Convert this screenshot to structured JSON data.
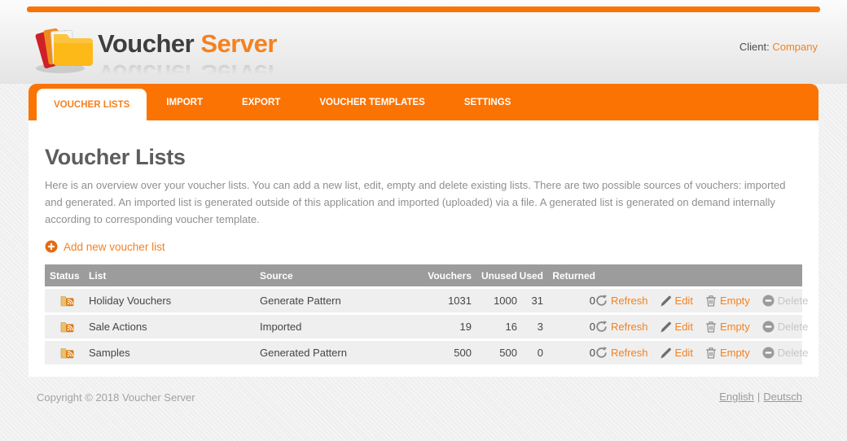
{
  "colors": {
    "accent_orange": "#fb7303",
    "link_orange": "#f5811f",
    "table_header_bg": "#9c9c9c",
    "row_bg": "#efefef",
    "disabled_text": "#c6c6c6"
  },
  "header": {
    "brand_primary": "Voucher",
    "brand_secondary": "Server",
    "client_label": "Client:",
    "client_name": "Company"
  },
  "nav": {
    "tabs": [
      {
        "label": "VOUCHER LISTS",
        "active": true
      },
      {
        "label": "IMPORT",
        "active": false
      },
      {
        "label": "EXPORT",
        "active": false
      },
      {
        "label": "VOUCHER TEMPLATES",
        "active": false
      },
      {
        "label": "SETTINGS",
        "active": false
      }
    ]
  },
  "main": {
    "title": "Voucher Lists",
    "description": "Here is an overview over your voucher lists. You can add a new list, edit, empty and delete existing lists. There are two possible sources of vouchers: imported and generated. An imported list is generated outside of this application and imported (uploaded) via a file. A generated list is generated on demand internally according to corresponding voucher template.",
    "add_link": "Add new voucher list"
  },
  "table": {
    "headers": {
      "status": "Status",
      "list": "List",
      "source": "Source",
      "vouchers": "Vouchers",
      "unused": "Unused",
      "used": "Used",
      "returned": "Returned"
    },
    "rows": [
      {
        "list": "Holiday Vouchers",
        "source": "Generate Pattern",
        "vouchers": "1031",
        "unused": "1000",
        "used": "31",
        "returned": "0"
      },
      {
        "list": "Sale Actions",
        "source": "Imported",
        "vouchers": "19",
        "unused": "16",
        "used": "3",
        "returned": "0"
      },
      {
        "list": "Samples",
        "source": "Generated Pattern",
        "vouchers": "500",
        "unused": "500",
        "used": "0",
        "returned": "0"
      }
    ],
    "actions": {
      "refresh": "Refresh",
      "edit": "Edit",
      "empty": "Empty",
      "delete": "Delete"
    }
  },
  "footer": {
    "copyright": "Copyright © 2018 Voucher Server",
    "language_1": "English",
    "separator": "|",
    "language_2": "Deutsch"
  }
}
